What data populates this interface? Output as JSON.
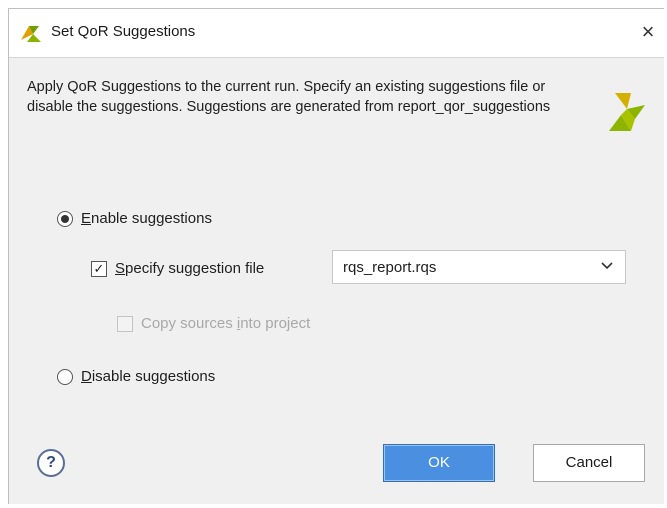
{
  "window": {
    "title": "Set QoR Suggestions",
    "close_glyph": "×",
    "title_icon": "vivado-logo-icon"
  },
  "description": "Apply QoR Suggestions to the current run. Specify an existing suggestions file or disable the suggestions. Suggestions are generated from report_qor_suggestions",
  "options": {
    "enable": {
      "mnemonic": "E",
      "rest": "nable suggestions",
      "selected": true
    },
    "specify_file": {
      "mnemonic": "S",
      "rest": "pecify suggestion file",
      "checked": true
    },
    "copy_sources": {
      "prefix": "Copy sources ",
      "mnemonic": "i",
      "rest": "nto project",
      "checked": false,
      "enabled": false
    },
    "disable": {
      "mnemonic": "D",
      "rest": "isable suggestions",
      "selected": false
    }
  },
  "file_combo": {
    "value": "rqs_report.rqs"
  },
  "buttons": {
    "help": "?",
    "ok": "OK",
    "cancel": "Cancel"
  },
  "colors": {
    "accent": "#4a8fe0",
    "logo_primary": "#8cb400",
    "logo_secondary": "#c8a400"
  }
}
